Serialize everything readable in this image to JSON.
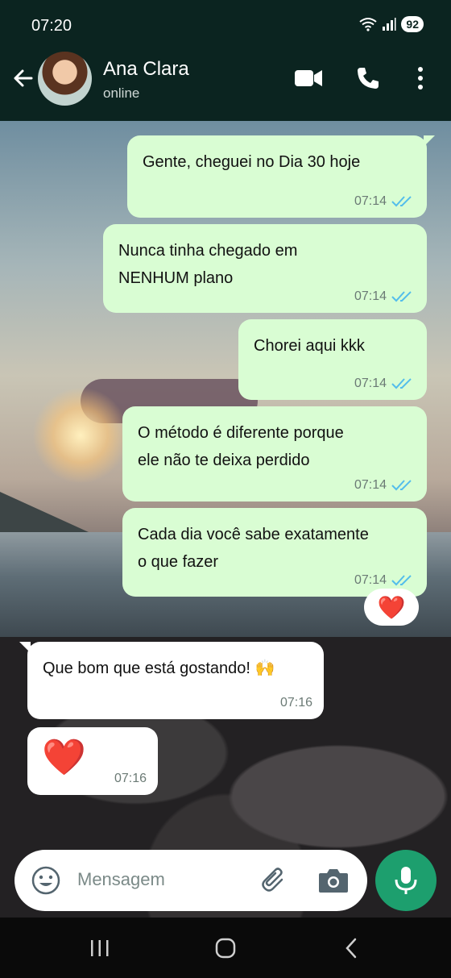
{
  "status_bar": {
    "time": "07:20",
    "battery": "92"
  },
  "header": {
    "contact_name": "Ana Clara",
    "presence": "online"
  },
  "messages": [
    {
      "direction": "out",
      "lines": [
        "Gente, cheguei no Dia 30 hoje"
      ],
      "time": "07:14",
      "status": "read"
    },
    {
      "direction": "out",
      "lines": [
        "Nunca tinha chegado em",
        "NENHUM plano"
      ],
      "time": "07:14",
      "status": "read"
    },
    {
      "direction": "out",
      "lines": [
        "Chorei aqui kkk"
      ],
      "time": "07:14",
      "status": "read"
    },
    {
      "direction": "out",
      "lines": [
        "O método é diferente porque",
        "ele não te deixa perdido"
      ],
      "time": "07:14",
      "status": "read"
    },
    {
      "direction": "out",
      "lines": [
        "Cada dia você sabe exatamente",
        "o que fazer"
      ],
      "time": "07:14",
      "status": "read",
      "reaction": "❤️"
    },
    {
      "direction": "in",
      "lines": [
        "Que bom que está gostando! 🙌"
      ],
      "time": "07:16"
    },
    {
      "direction": "in",
      "lines": [
        "❤️"
      ],
      "time": "07:16"
    }
  ],
  "composer": {
    "placeholder": "Mensagem"
  },
  "icons": {
    "back": "back-arrow-icon",
    "video": "video-call-icon",
    "call": "phone-icon",
    "menu": "more-vert-icon",
    "emoji": "emoji-icon",
    "attach": "paperclip-icon",
    "camera": "camera-icon",
    "mic": "mic-icon",
    "read_receipt": "double-check-icon"
  },
  "colors": {
    "header": "#0b2420",
    "outgoing_bubble": "#d9fdd3",
    "incoming_bubble": "#ffffff",
    "read_tick": "#53bdeb",
    "mic_button": "#1d9f6e"
  }
}
